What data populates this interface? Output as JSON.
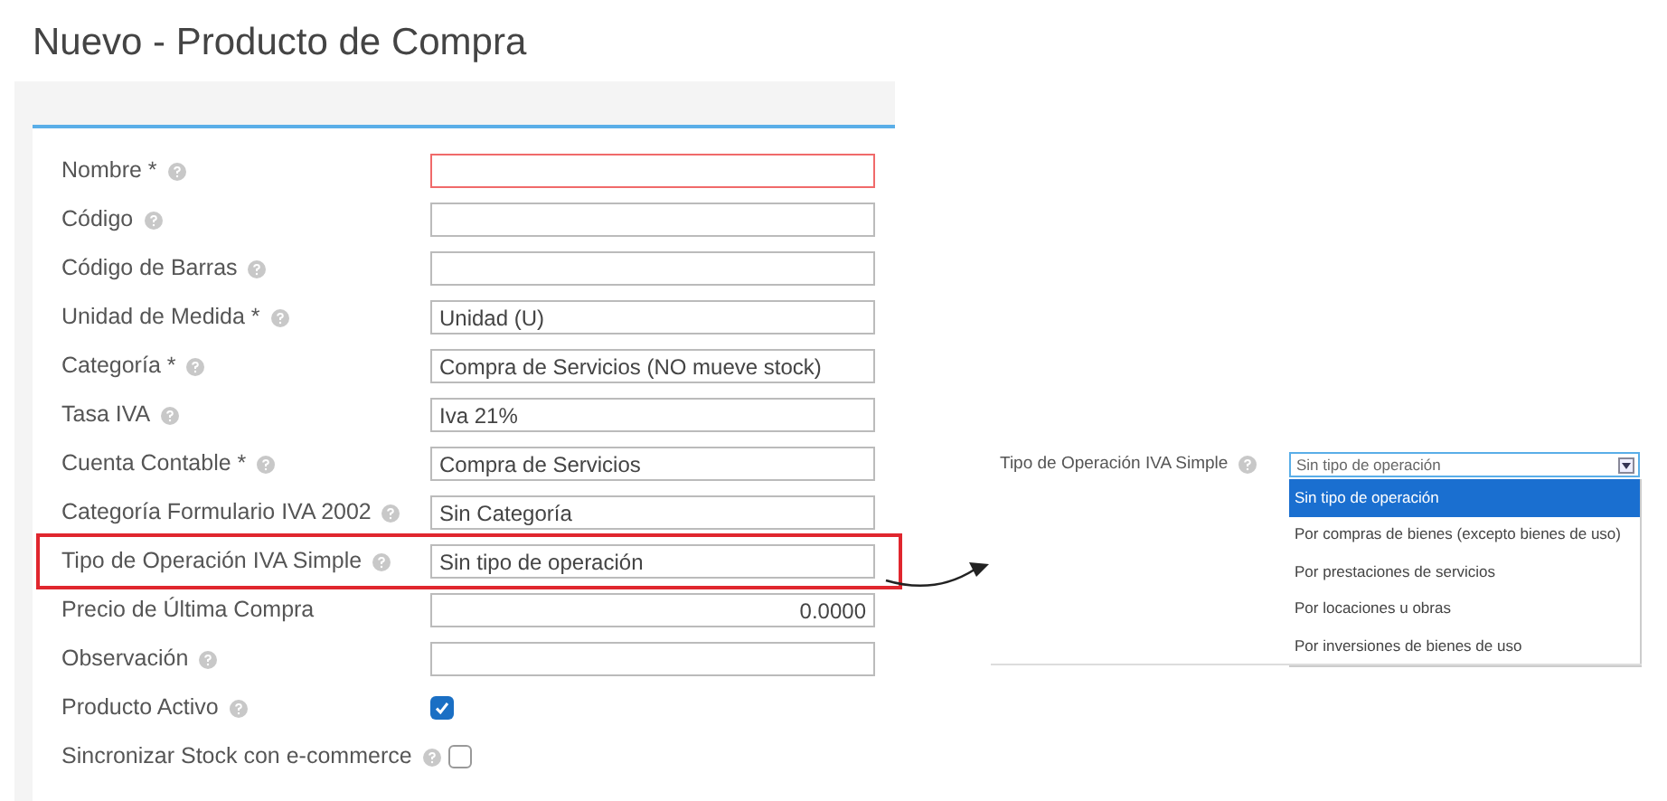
{
  "page_title": "Nuevo - Producto de Compra",
  "fields": [
    {
      "kind": "text",
      "label": "Nombre *",
      "help": true,
      "error": true,
      "highlighted": false
    },
    {
      "kind": "text",
      "label": "Código",
      "help": true,
      "error": false,
      "highlighted": false
    },
    {
      "kind": "text",
      "label": "Código de Barras",
      "help": true,
      "error": false,
      "highlighted": false
    },
    {
      "kind": "text",
      "label": "Unidad de Medida *",
      "help": true,
      "value": "Unidad (U)",
      "error": false,
      "highlighted": false
    },
    {
      "kind": "text",
      "label": "Categoría *",
      "help": true,
      "value": "Compra de Servicios (NO mueve stock)",
      "error": false,
      "highlighted": false
    },
    {
      "kind": "text",
      "label": "Tasa IVA",
      "help": true,
      "value": "Iva 21%",
      "error": false,
      "highlighted": false
    },
    {
      "kind": "text",
      "label": "Cuenta Contable *",
      "help": true,
      "value": "Compra de Servicios",
      "error": false,
      "highlighted": false
    },
    {
      "kind": "text",
      "label": "Categoría Formulario IVA 2002",
      "help": true,
      "value": "Sin Categoría",
      "error": false,
      "highlighted": false
    },
    {
      "kind": "text",
      "label": "Tipo de Operación IVA Simple",
      "help": true,
      "value": "Sin tipo de operación",
      "error": false,
      "highlighted": true
    },
    {
      "kind": "number",
      "label": "Precio de Última Compra",
      "help": false,
      "value": "0.0000",
      "error": false,
      "highlighted": false
    },
    {
      "kind": "text",
      "label": "Observación",
      "help": true,
      "error": false,
      "highlighted": false
    },
    {
      "kind": "checkbox",
      "label": "Producto Activo",
      "help": true,
      "checked": true
    },
    {
      "kind": "checkbox",
      "label": "Sincronizar Stock con e-commerce",
      "help": true,
      "checked": false
    }
  ],
  "detail": {
    "label": "Tipo de Operación IVA Simple",
    "value": "Sin tipo de operación",
    "options": [
      {
        "label": "Sin tipo de operación",
        "selected": true
      },
      {
        "label": "Por compras de bienes (excepto bienes de uso)",
        "selected": false
      },
      {
        "label": "Por prestaciones de servicios",
        "selected": false
      },
      {
        "label": "Por locaciones u obras",
        "selected": false
      },
      {
        "label": "Por inversiones de bienes de uso",
        "selected": false
      }
    ]
  }
}
